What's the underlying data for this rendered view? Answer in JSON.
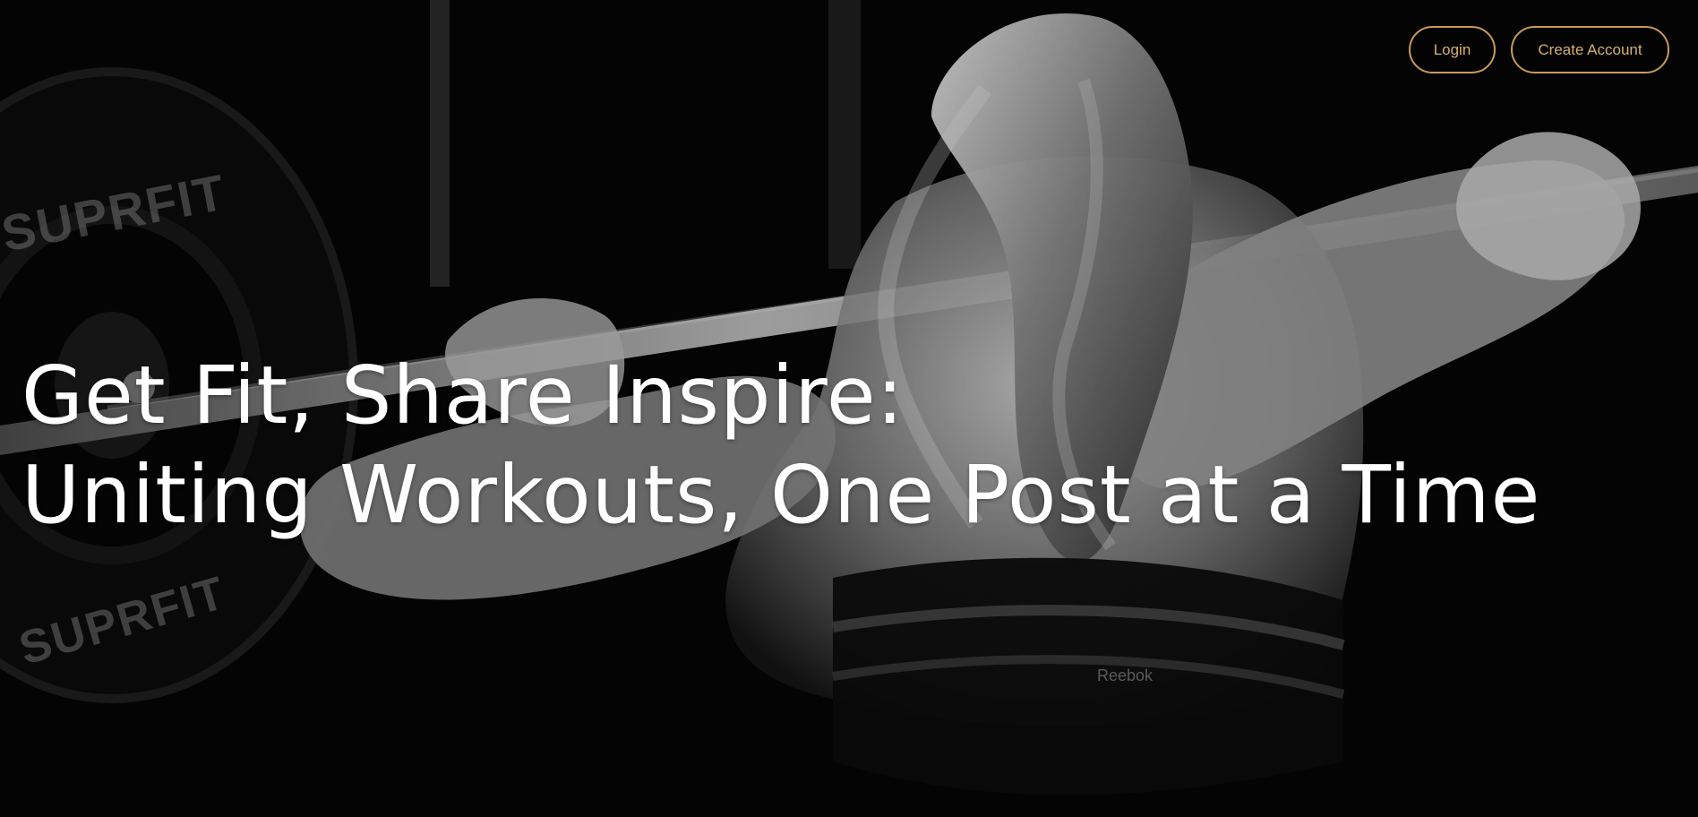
{
  "hero": {
    "headline_line1": "Get Fit, Share Inspire:",
    "headline_line2": "Uniting Workouts, One Post at a Time",
    "plate_top_text": "SUPRFIT",
    "plate_bottom_text": "SUPRFIT",
    "top_label": "Reebok"
  },
  "header": {
    "login_label": "Login",
    "create_account_label": "Create Account"
  },
  "colors": {
    "accent_gold": "#c99b58",
    "headline": "#ffffff",
    "background": "#000000"
  }
}
